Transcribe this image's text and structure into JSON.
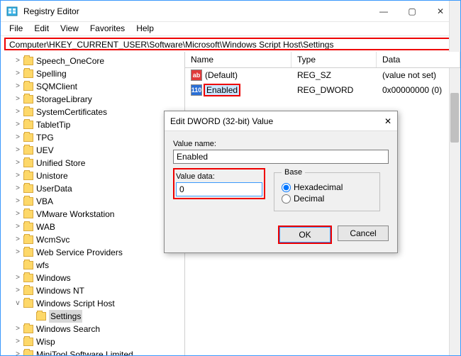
{
  "window": {
    "title": "Registry Editor",
    "min": "—",
    "max": "▢",
    "close": "✕"
  },
  "menu": {
    "file": "File",
    "edit": "Edit",
    "view": "View",
    "favorites": "Favorites",
    "help": "Help"
  },
  "address": "Computer\\HKEY_CURRENT_USER\\Software\\Microsoft\\Windows Script Host\\Settings",
  "tree": {
    "items": [
      {
        "label": "Speech_OneCore",
        "exp": ">"
      },
      {
        "label": "Spelling",
        "exp": ">"
      },
      {
        "label": "SQMClient",
        "exp": ">"
      },
      {
        "label": "StorageLibrary",
        "exp": ">"
      },
      {
        "label": "SystemCertificates",
        "exp": ">"
      },
      {
        "label": "TabletTip",
        "exp": ">"
      },
      {
        "label": "TPG",
        "exp": ">"
      },
      {
        "label": "UEV",
        "exp": ">"
      },
      {
        "label": "Unified Store",
        "exp": ">"
      },
      {
        "label": "Unistore",
        "exp": ">"
      },
      {
        "label": "UserData",
        "exp": ">"
      },
      {
        "label": "VBA",
        "exp": ">"
      },
      {
        "label": "VMware Workstation",
        "exp": ">"
      },
      {
        "label": "WAB",
        "exp": ">"
      },
      {
        "label": "WcmSvc",
        "exp": ">"
      },
      {
        "label": "Web Service Providers",
        "exp": ">"
      },
      {
        "label": "wfs",
        "exp": ""
      },
      {
        "label": "Windows",
        "exp": ">"
      },
      {
        "label": "Windows NT",
        "exp": ">"
      },
      {
        "label": "Windows Script Host",
        "exp": "v",
        "children": [
          {
            "label": "Settings",
            "selected": true
          }
        ]
      },
      {
        "label": "Windows Search",
        "exp": ">"
      },
      {
        "label": "Wisp",
        "exp": ">"
      },
      {
        "label": "MiniTool Software Limited",
        "exp": ">"
      }
    ]
  },
  "list": {
    "headers": {
      "name": "Name",
      "type": "Type",
      "data": "Data"
    },
    "rows": [
      {
        "icon": "str",
        "name": "(Default)",
        "type": "REG_SZ",
        "data": "(value not set)"
      },
      {
        "icon": "num",
        "name": "Enabled",
        "type": "REG_DWORD",
        "data": "0x00000000 (0)",
        "selected": true
      }
    ]
  },
  "dialog": {
    "title": "Edit DWORD (32-bit) Value",
    "close": "✕",
    "value_name_label": "Value name:",
    "value_name": "Enabled",
    "value_data_label": "Value data:",
    "value_data": "0",
    "base_label": "Base",
    "hex": "Hexadecimal",
    "dec": "Decimal",
    "ok": "OK",
    "cancel": "Cancel"
  }
}
